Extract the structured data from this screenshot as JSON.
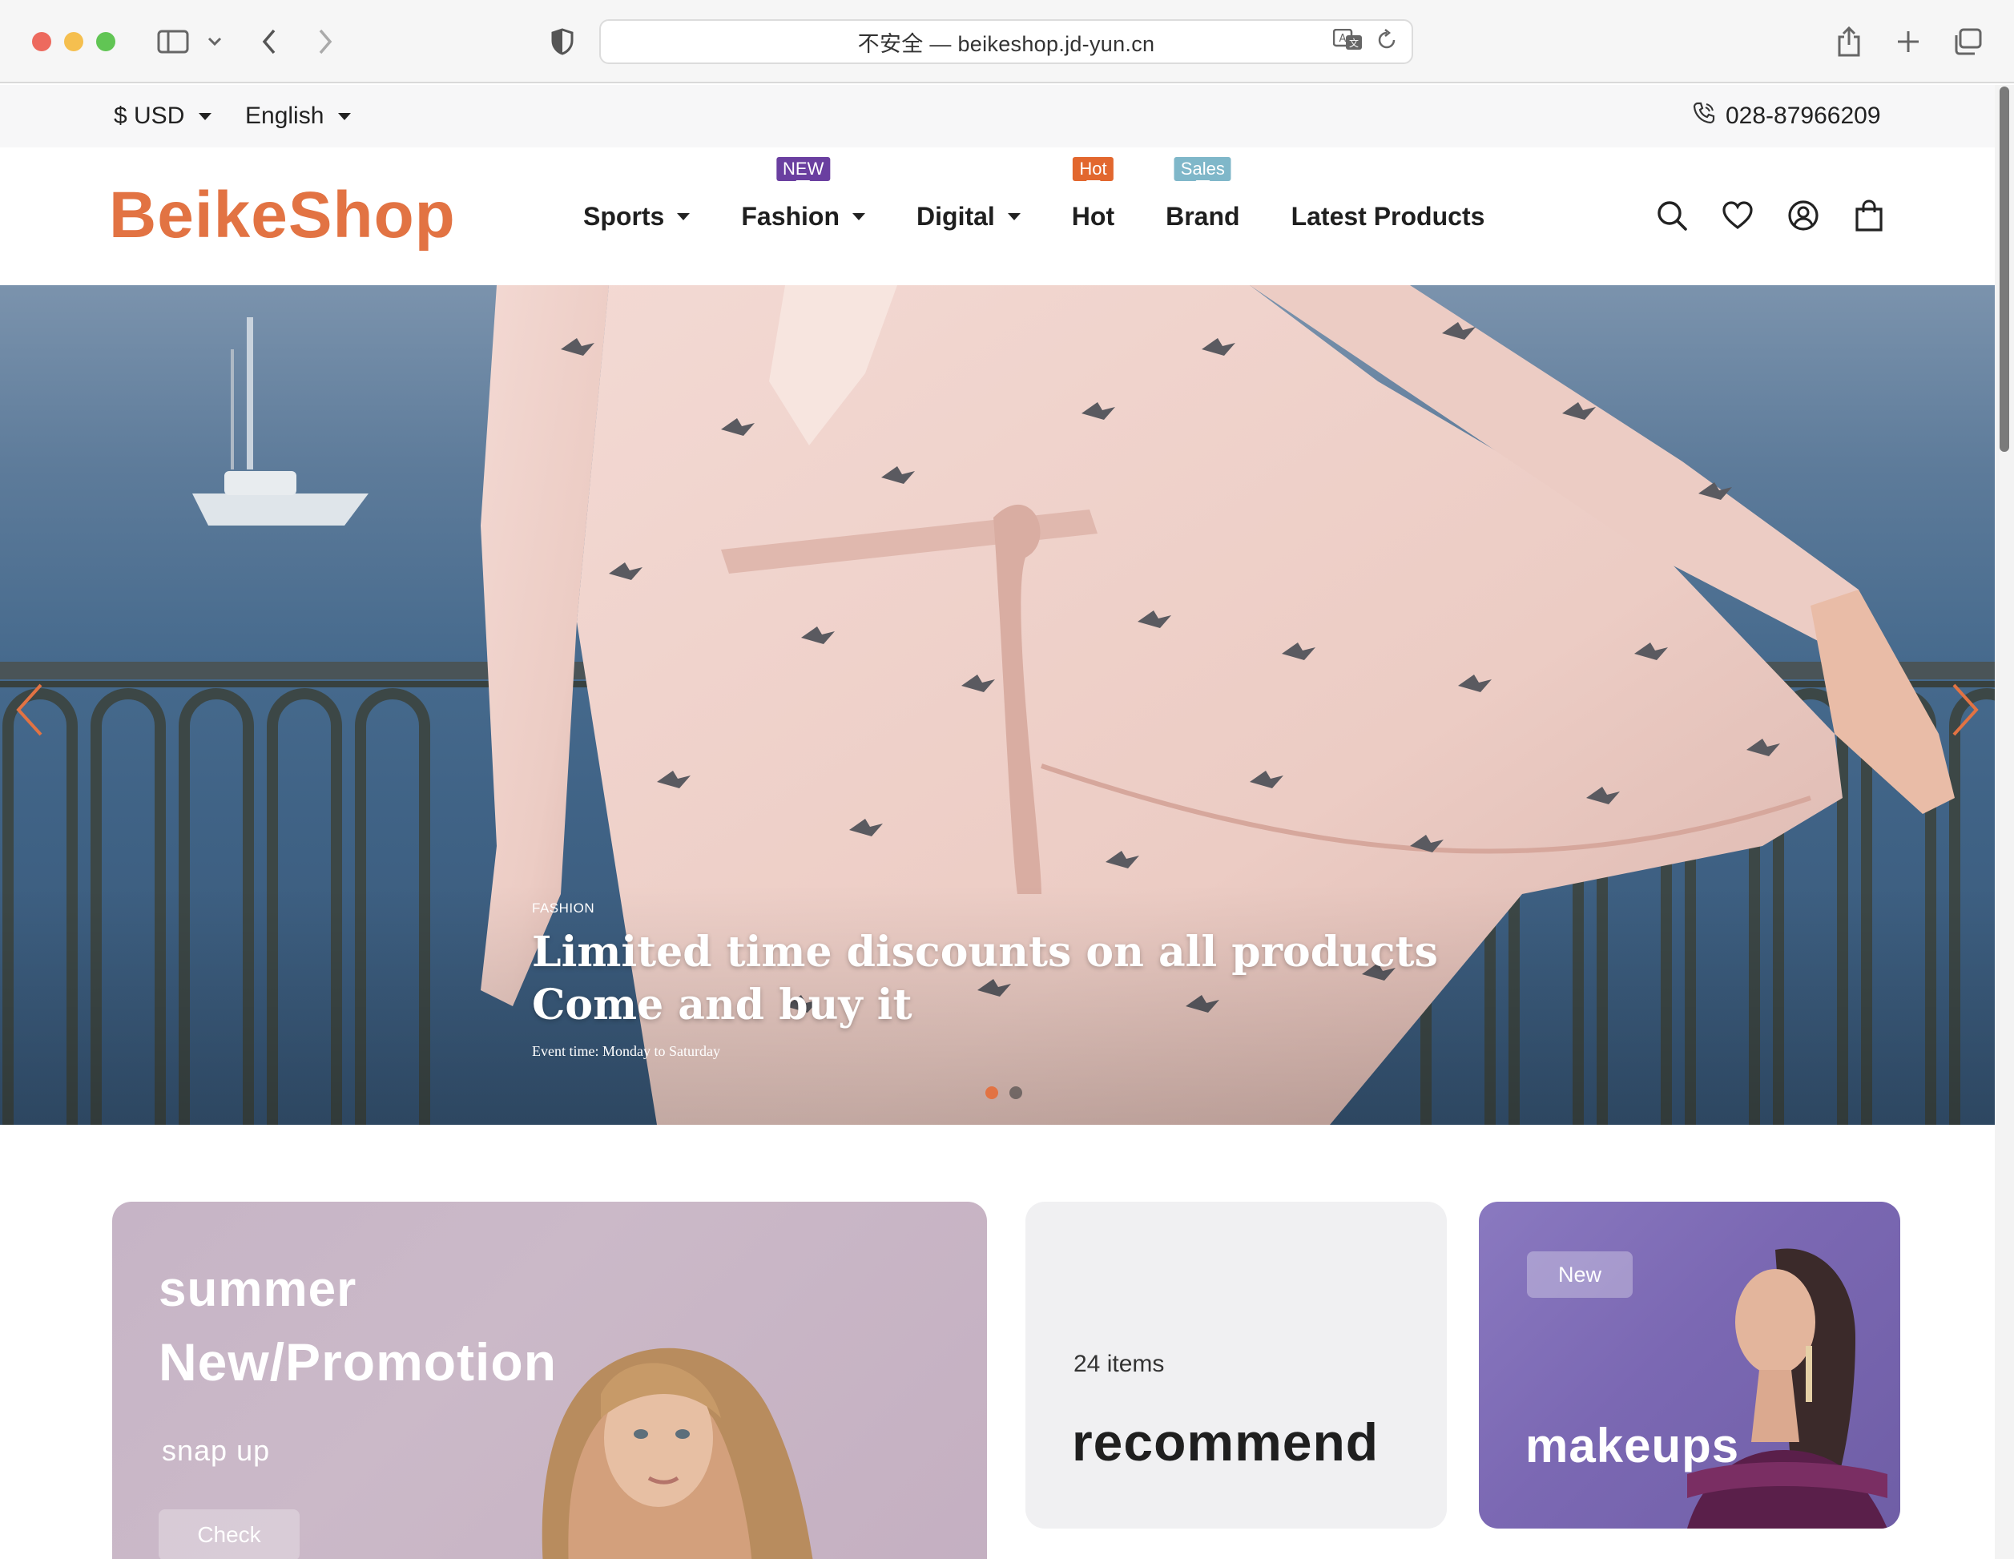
{
  "browser": {
    "url_text": "不安全 — beikeshop.jd-yun.cn"
  },
  "topbar": {
    "currency": "$ USD",
    "language": "English",
    "phone": "028-87966209"
  },
  "header": {
    "logo": "BeikeShop",
    "nav": [
      {
        "label": "Sports",
        "badge": ""
      },
      {
        "label": "Fashion",
        "badge": "NEW"
      },
      {
        "label": "Digital",
        "badge": ""
      },
      {
        "label": "Hot",
        "badge": "Hot"
      },
      {
        "label": "Brand",
        "badge": "Sales"
      },
      {
        "label": "Latest Products",
        "badge": ""
      }
    ],
    "badge_colors": {
      "new": "#6a3fa0",
      "hot": "#e2672e",
      "sales": "#7fb7c9"
    }
  },
  "hero": {
    "eyebrow": "FASHION",
    "title_line1": "Limited time discounts on all products",
    "title_line2": "Come and buy it",
    "subtitle": "Event time: Monday to Saturday",
    "slide_count": 2,
    "active_slide": 1
  },
  "cards": {
    "summer": {
      "line1": "summer",
      "line2": "New/Promotion",
      "line3": "snap up",
      "button": "Check"
    },
    "recommend": {
      "count": "24 items",
      "title": "recommend"
    },
    "makeups": {
      "badge": "New",
      "title": "makeups"
    }
  },
  "colors": {
    "accent": "#e27343"
  }
}
